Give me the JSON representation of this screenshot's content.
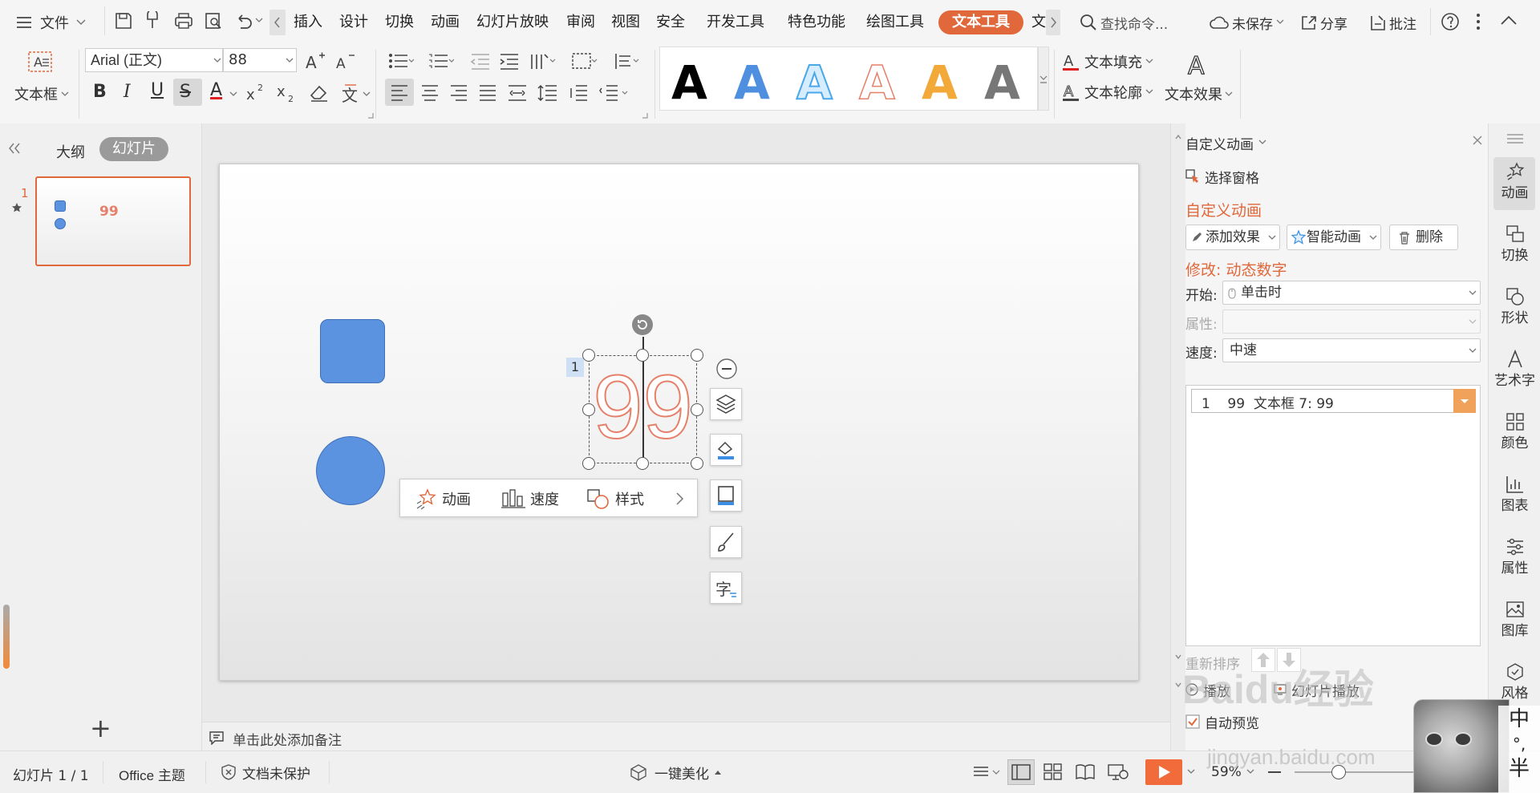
{
  "menubar": {
    "file": "文件",
    "tabs": [
      "插入",
      "设计",
      "切换",
      "动画",
      "幻灯片放映",
      "审阅",
      "视图",
      "安全",
      "开发工具",
      "特色功能",
      "绘图工具"
    ],
    "active_tab": "文本工具",
    "partial_tab": "文",
    "search": "查找命令...",
    "unsaved": "未保存",
    "share": "分享",
    "annotate": "批注"
  },
  "ribbon": {
    "textbox": "文本框",
    "font_name": "Arial (正文)",
    "font_size": "88",
    "wordart_letter": "A",
    "text_fill": "文本填充",
    "text_outline": "文本轮廓",
    "text_effect": "文本效果",
    "fmt": {
      "bold": "B",
      "italic": "I",
      "underline": "U",
      "strike": "S",
      "color": "A"
    }
  },
  "left": {
    "tab_outline": "大纲",
    "tab_slides": "幻灯片",
    "slide_number": "1",
    "thumb_text": "99",
    "add": "+"
  },
  "slide": {
    "anim_order": "1",
    "number_text": "99",
    "toolbar": {
      "anim": "动画",
      "speed": "速度",
      "style": "样式"
    }
  },
  "notes": {
    "placeholder": "单击此处添加备注"
  },
  "panel": {
    "title": "自定义动画",
    "select_pane": "选择窗格",
    "section": "自定义动画",
    "add_effect": "添加效果",
    "smart_anim": "智能动画",
    "delete": "删除",
    "modify": "修改: 动态数字",
    "start_label": "开始:",
    "start_value": "单击时",
    "prop_label": "属性:",
    "speed_label": "速度:",
    "speed_value": "中速",
    "list_item": "1    99  文本框 7: 99",
    "reorder": "重新排序",
    "play": "播放",
    "slideshow": "幻灯片播放",
    "autopreview": "自动预览"
  },
  "sidebar": {
    "items": [
      "动画",
      "切换",
      "形状",
      "艺术字",
      "颜色",
      "图表",
      "属性",
      "图库",
      "风格"
    ]
  },
  "statusbar": {
    "slide": "幻灯片 1 / 1",
    "theme": "Office 主题",
    "protect": "文档未保护",
    "beautify": "一键美化",
    "zoom": "59%",
    "ime_1": "中",
    "ime_2": "°,",
    "ime_3": "半"
  },
  "watermark": {
    "line1": "Baidu经验",
    "line2": "jingyan.baidu.com"
  },
  "colors": {
    "accent": "#e0683b",
    "shape": "#5b93e0",
    "number": "#e5806a"
  }
}
